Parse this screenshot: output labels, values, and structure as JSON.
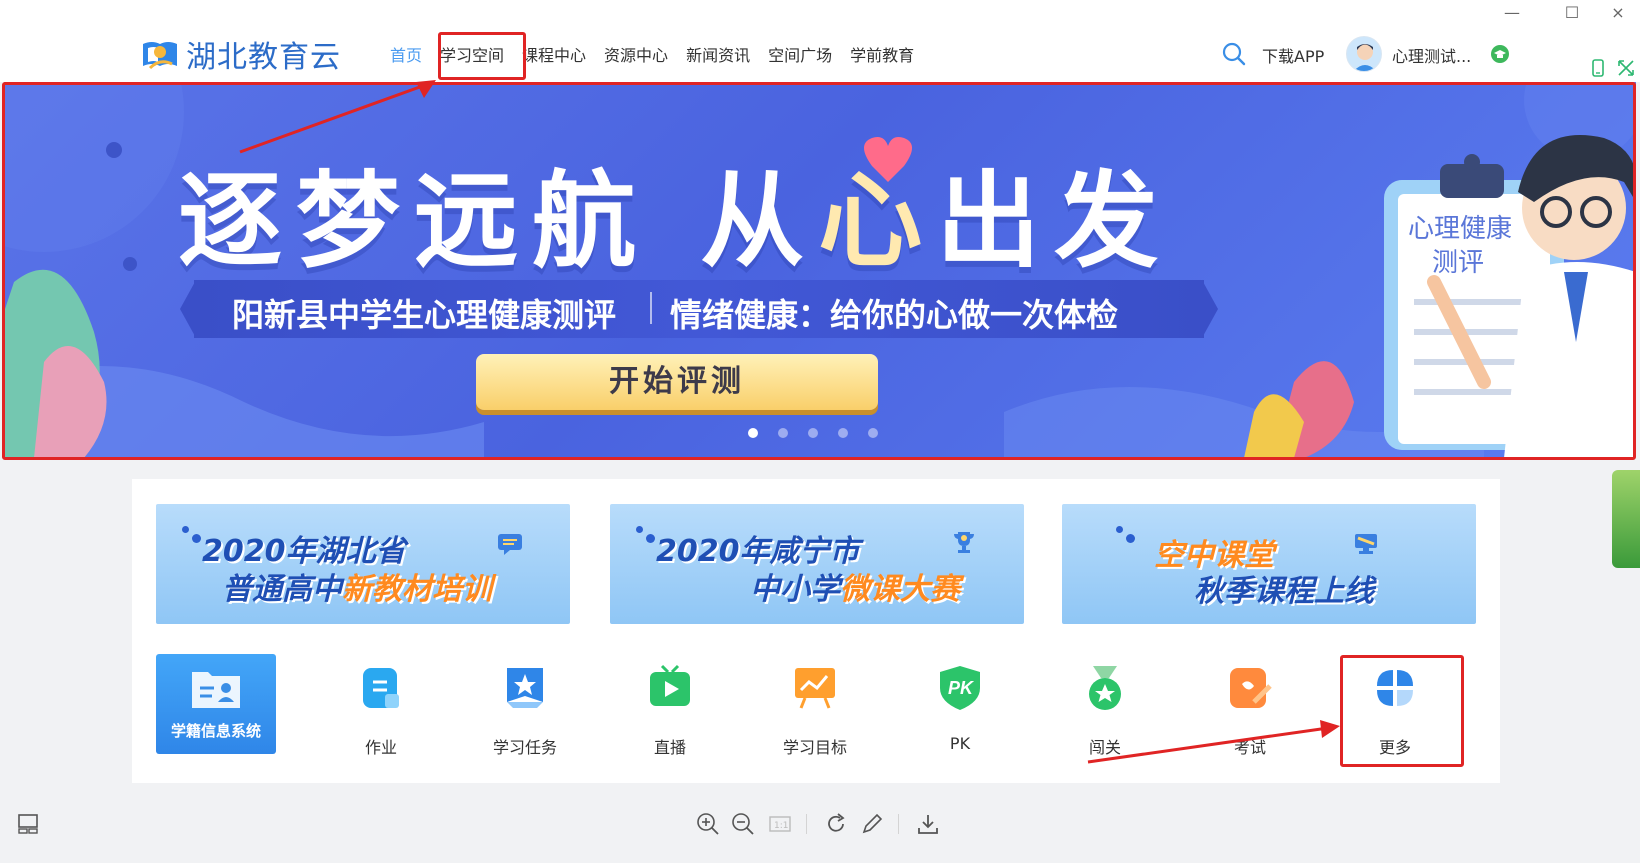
{
  "window": {
    "minimize": "—",
    "maximize": "☐",
    "close": "×"
  },
  "header": {
    "logo_text": "湖北教育云",
    "nav": [
      "首页",
      "学习空间",
      "课程中心",
      "资源中心",
      "新闻资讯",
      "空间广场",
      "学前教育"
    ],
    "download_app": "下载APP",
    "username": "心理测试..."
  },
  "banner": {
    "slogan_part1": "逐梦远航 从",
    "slogan_heart": "心",
    "slogan_part2": "出发",
    "ribbon_left": "阳新县中学生心理健康测评",
    "ribbon_right": "情绪健康：给你的心做一次体检",
    "button": "开始评测",
    "clipboard_line1": "心理健康",
    "clipboard_line2": "测评",
    "slides": 5,
    "active_slide": 1
  },
  "promos": [
    {
      "line1": "2020年湖北省",
      "line2_a": "普通高中",
      "line2_b": "新教材培训"
    },
    {
      "line1": "2020年咸宁市",
      "line2_a": "中小学",
      "line2_b": "微课大赛"
    },
    {
      "line1_a": "空中课堂",
      "line2": "秋季课程上线"
    }
  ],
  "apps": {
    "featured": "学籍信息系统",
    "items": [
      "作业",
      "学习任务",
      "直播",
      "学习目标",
      "PK",
      "闯关",
      "考试",
      "更多"
    ]
  },
  "colors": {
    "accent": "#4b9bf0",
    "banner_bg": "#4a63df",
    "highlight": "#e02424"
  }
}
